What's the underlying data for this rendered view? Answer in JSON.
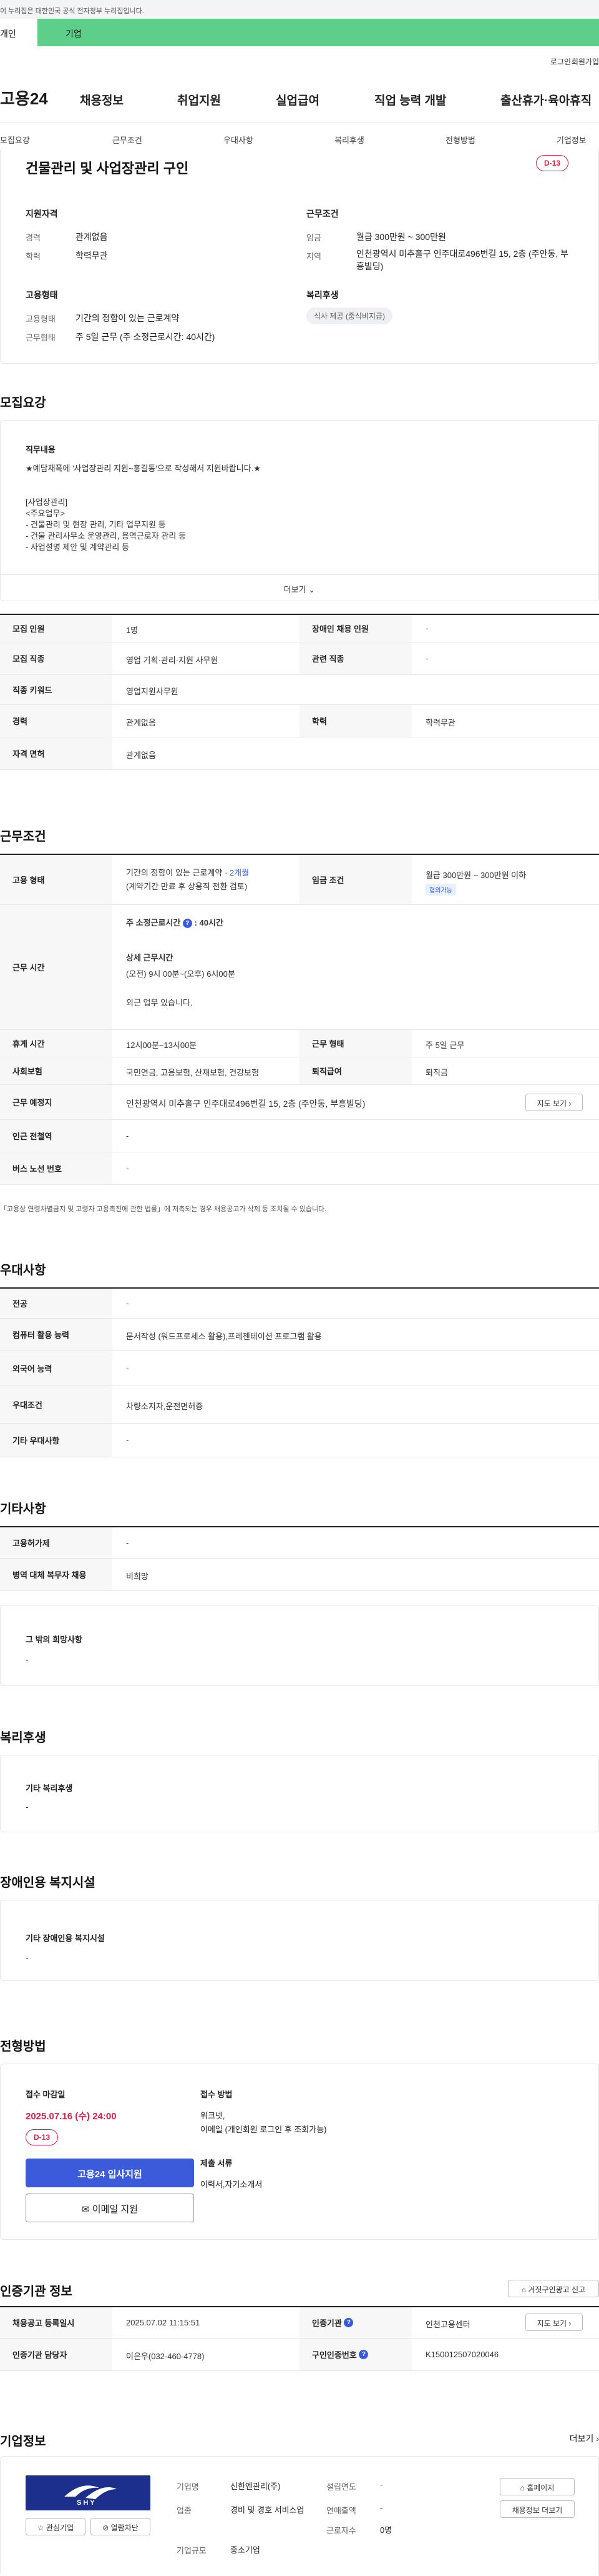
{
  "gov_banner": {
    "text": "이 누리집은 대한민국 공식 전자정부 누리집입니다."
  },
  "top_tabs": {
    "personal": "개인",
    "company": "기업"
  },
  "utility": {
    "login": "로그인",
    "join": "회원가입"
  },
  "gnb": {
    "logo": "고용24",
    "items": [
      "채용정보",
      "취업지원",
      "실업급여",
      "직업 능력 개발",
      "출산휴가·육아휴직"
    ]
  },
  "anchor_tabs": [
    "모집요강",
    "근무조건",
    "우대사항",
    "복리후생",
    "전형방법",
    "기업정보"
  ],
  "summary": {
    "title": "건물관리 및 사업장관리 구인",
    "dday": "D-13",
    "qualification_title": "지원자격",
    "career_label": "경력",
    "career_value": "관계없음",
    "education_label": "학력",
    "education_value": "학력무관",
    "condition_title": "근무조건",
    "wage_label": "임금",
    "wage_value": "월급 300만원 ~ 300만원",
    "location_label": "지역",
    "location_value": "인천광역시 미추홀구 인주대로496번길 15, 2층 (주안동, 부흥빌딩)",
    "employment_title": "고용형태",
    "emp_type_label": "고용형태",
    "emp_type_value": "기간의 정함이 있는 근로계약",
    "work_type_label": "근무형태",
    "work_type_value": "주 5일 근무 (주 소정근로시간: 40시간)",
    "welfare_title": "복리후생",
    "welfare_chip": "식사 제공 (중식비지급)"
  },
  "recruit": {
    "section_title": "모집요강",
    "duty_title": "직무내용",
    "duty_lines": [
      "★예담채폭에 '사업장관리 지원~홍길동'으로 작성해서 지원바랍니다.★",
      "",
      "[사업장관리]",
      "<주요업무>",
      "- 건물관리 및 현장 관리, 기타 업무지원 등",
      "- 건물 관리사무소 운영관리, 용역근로자 관리 등",
      "- 사업설명 제안 및 계약관리 등"
    ],
    "more": "더보기",
    "rows": [
      {
        "k1": "모집 인원",
        "v1": "1명",
        "k2": "장애인 채용 인원",
        "v2": "-"
      },
      {
        "k1": "모집 직종",
        "v1": "영업 기획·관리·지원 사무원",
        "k2": "관련 직종",
        "v2": "-"
      },
      {
        "k1": "직종 키워드",
        "v1": "영업지원사무원",
        "k2": "",
        "v2": ""
      },
      {
        "k1": "경력",
        "v1": "관계없음",
        "k2": "학력",
        "v2": "학력무관"
      },
      {
        "k1": "자격 면허",
        "v1": "관계없음",
        "k2": "",
        "v2": ""
      }
    ]
  },
  "work": {
    "section_title": "근무조건",
    "emp_label": "고용 형태",
    "emp_value_a": "기간의 정함이 있는 근로계약 · ",
    "emp_value_b": "2개월",
    "emp_value_c": "(계약기간 만료 후 상용직 전환 검토)",
    "wage_label": "임금 조건",
    "wage_value": "월급 300만원 ~ 300만원 이하",
    "wage_chip": "협의가능",
    "hours_label": "근무 시간",
    "hours_total": "주 소정근로시간",
    "hours_total_value": ": 40시간",
    "hours_detail_title": "상세 근무시간",
    "hours_detail": "(오전) 9시 00분~(오후) 6시00분",
    "hours_extra": "외근 업무 있습니다.",
    "break_label": "휴게 시간",
    "break_value": "12시00분~13시00분",
    "work_type_label": "근무 형태",
    "work_type_value": "주 5일 근무",
    "insurance_label": "사회보험",
    "insurance_value": "국민연금, 고용보험, 산재보험, 건강보험",
    "retire_label": "퇴직급여",
    "retire_value": "퇴직금",
    "place_label": "근무 예정지",
    "place_value": "인천광역시 미추홀구 인주대로496번길 15, 2층 (주안동, 부흥빌딩)",
    "map_btn": "지도 보기",
    "subway_label": "인근 전철역",
    "subway_value": "-",
    "bus_label": "버스 노선 번호",
    "bus_value": "-",
    "note": "「고용상 연령차별금지 및 고령자 고용촉진에 관한 법률」에 저촉되는 경우 채용공고가 삭제 등 조치될 수 있습니다."
  },
  "preference": {
    "section_title": "우대사항",
    "rows": [
      {
        "k": "전공",
        "v": "-"
      },
      {
        "k": "컴퓨터 활용 능력",
        "v": "문서작성 (워드프로세스 활용),프레젠테이션 프로그램 활용"
      },
      {
        "k": "외국어 능력",
        "v": "-"
      },
      {
        "k": "우대조건",
        "v": "차량소지자,운전면허증"
      },
      {
        "k": "기타 우대사항",
        "v": "-"
      }
    ]
  },
  "etc": {
    "section_title": "기타사항",
    "rows": [
      {
        "k": "고용허가제",
        "v": "-"
      },
      {
        "k": "병역 대체 복무자 채용",
        "v": "비희망"
      }
    ],
    "other_title": "그 밖의 희망사항",
    "other_value": "-"
  },
  "welfare": {
    "section_title": "복리후생",
    "box_title": "기타 복리후생",
    "box_value": "-"
  },
  "disabled": {
    "section_title": "장애인용 복지시설",
    "box_title": "기타 장애인용 복지시설",
    "box_value": "-"
  },
  "process": {
    "section_title": "전형방법",
    "deadline_label": "접수 마감일",
    "deadline_value": "2025.07.16 (수) 24:00",
    "dday": "D-13",
    "apply_btn": "고용24 입사지원",
    "mail_btn": "이메일 지원",
    "method_label": "접수 방법",
    "method_value": "워크넷,\n이메일 (개인회원 로그인 후 조회가능)",
    "docs_label": "제출 서류",
    "docs_value": "이력서,자기소개서"
  },
  "agency": {
    "section_title": "인증기관 정보",
    "report_btn": "거짓구인광고 신고",
    "reg_label": "채용공고 등록일시",
    "reg_value": "2025.07.02 11:15:51",
    "agency_label": "인증기관",
    "agency_value": "인천고용센터",
    "map_btn": "지도 보기",
    "manager_label": "인증기관 담당자",
    "manager_value": "이은우(032-460-4778)",
    "no_label": "구인인증번호",
    "no_value": "K150012507020046"
  },
  "company": {
    "section_title": "기업정보",
    "more": "더보기",
    "logo_text": "SHY",
    "interest_btn": "관심기업",
    "review_btn": "열람차단",
    "name_label": "기업명",
    "name_value": "신한엔관리(주)",
    "industry_label": "업종",
    "industry_value": "경비 및 경호 서비스업",
    "size_label": "기업규모",
    "size_value": "중소기업",
    "founded_label": "설립연도",
    "founded_value": "-",
    "sales_label": "연매출액",
    "sales_value": "-",
    "staff_label": "근로자수",
    "staff_value": "0명",
    "homepage_btn": "홈페이지",
    "jobs_btn": "채용정보 더보기"
  }
}
